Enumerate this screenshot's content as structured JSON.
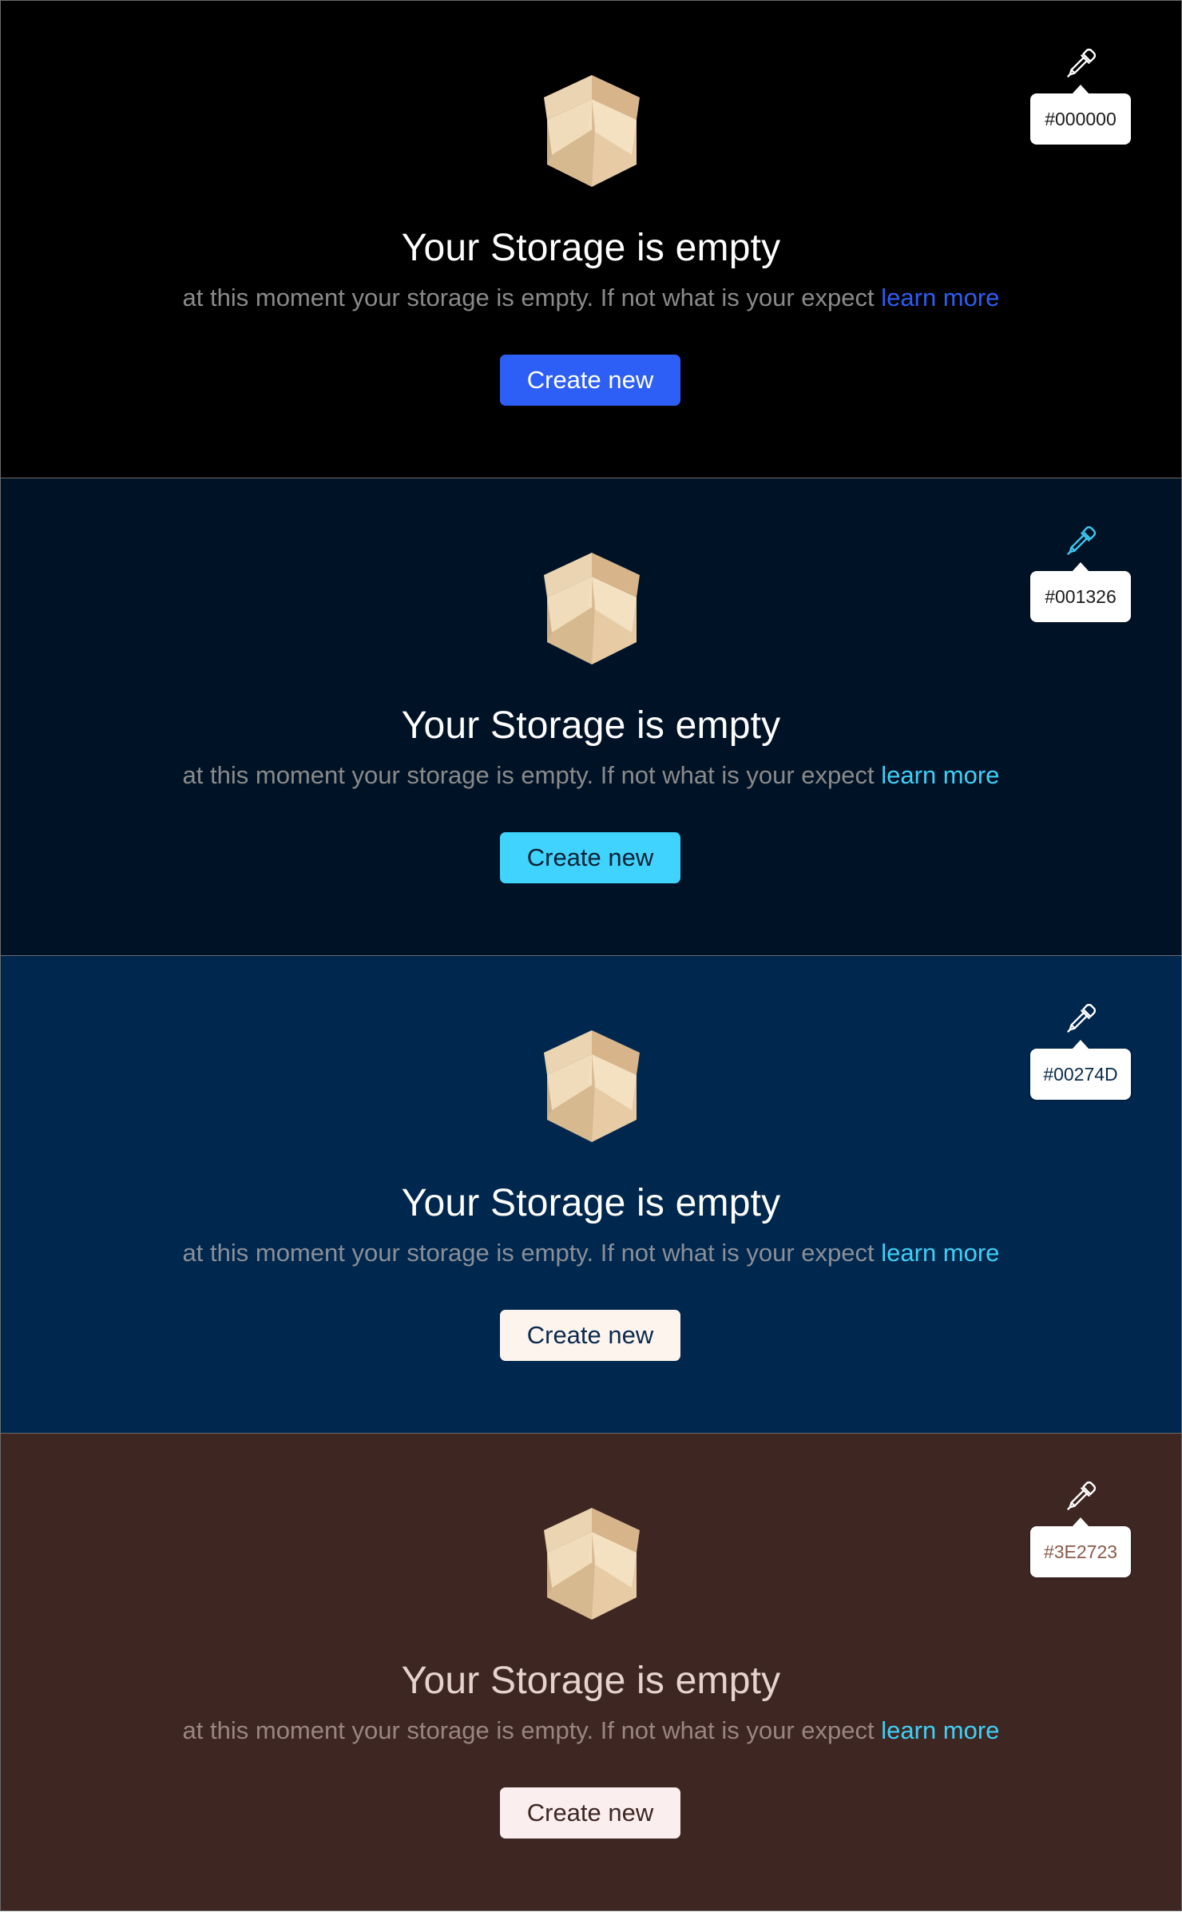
{
  "panels": [
    {
      "id": "black",
      "bg": "#000000",
      "hex_label": "#000000",
      "hex_label_color": "#1b1b1b",
      "picker_icon_color": "#ffffff",
      "title": "Your Storage is empty",
      "title_color": "#ffffff",
      "subtitle": "at this moment your storage is empty. If not what is your expect",
      "subtitle_color": "#8a8a8a",
      "link": "learn more",
      "link_color": "#2c5df5",
      "button_label": "Create new",
      "button_bg": "#2d5ff7",
      "button_text_color": "#ffffff"
    },
    {
      "id": "navy-dark",
      "bg": "#001326",
      "hex_label": "#001326",
      "hex_label_color": "#1b1b1b",
      "picker_icon_color": "#3ec9f0",
      "title": "Your Storage is empty",
      "title_color": "#ffffff",
      "subtitle": "at this moment your storage is empty. If not what is your expect",
      "subtitle_color": "#8a8a8a",
      "link": "learn more",
      "link_color": "#3fd0f7",
      "button_label": "Create new",
      "button_bg": "#3fd3fd",
      "button_text_color": "#0a2033"
    },
    {
      "id": "navy",
      "bg": "#00274D",
      "hex_label": "#00274D",
      "hex_label_color": "#0b2a4d",
      "picker_icon_color": "#ffffff",
      "title": "Your Storage is empty",
      "title_color": "#ffffff",
      "subtitle": "at this moment your storage is empty. If not what is your expect",
      "subtitle_color": "#8a8f98",
      "link": "learn more",
      "link_color": "#3fd0f7",
      "button_label": "Create new",
      "button_bg": "#fdf4ee",
      "button_text_color": "#0b2a4d"
    },
    {
      "id": "brown",
      "bg": "#3E2723",
      "hex_label": "#3E2723",
      "hex_label_color": "#8b5a48",
      "picker_icon_color": "#ffffff",
      "title": "Your Storage is empty",
      "title_color": "#e6d3cc",
      "subtitle": "at this moment your storage is empty. If not what is your expect",
      "subtitle_color": "#9a8580",
      "link": "learn more",
      "link_color": "#3fd0f7",
      "button_label": "Create new",
      "button_bg": "#fbeeee",
      "button_text_color": "#3e2723"
    }
  ],
  "icons": {
    "box": "open-box-icon",
    "picker": "eyedropper-icon"
  }
}
